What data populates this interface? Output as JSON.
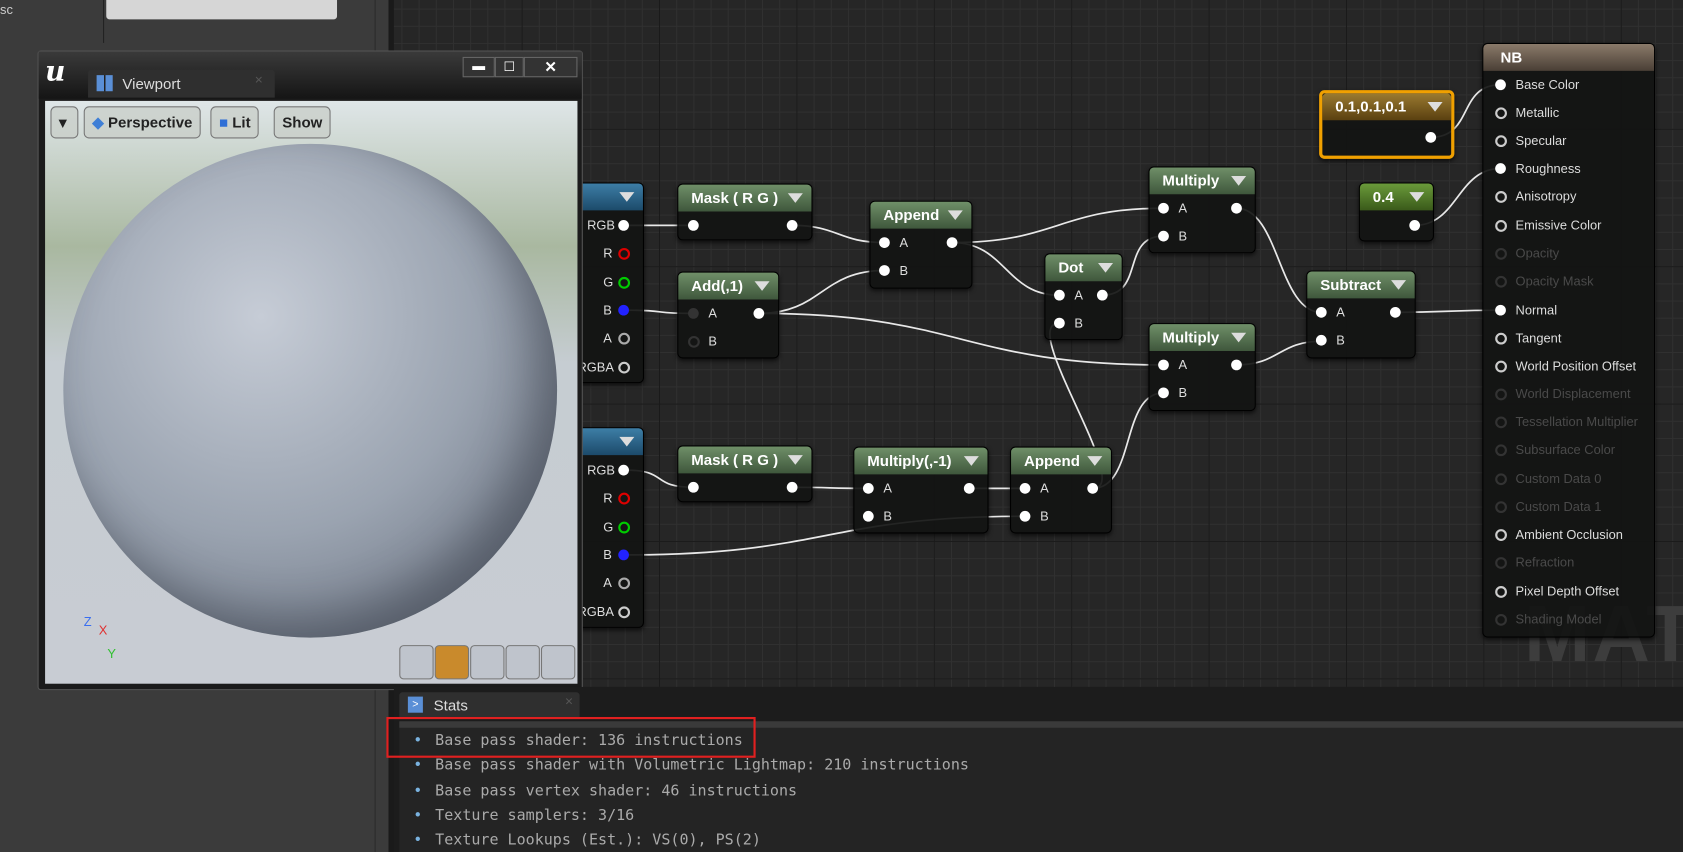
{
  "left_panel": {
    "label_fragment": "sc"
  },
  "viewport": {
    "tab_title": "Viewport",
    "view_mode": "Perspective",
    "lighting": "Lit",
    "show_label": "Show",
    "axes": {
      "x": "X",
      "y": "Y",
      "z": "Z"
    },
    "preview_shapes": [
      "cylinder-icon",
      "sphere-icon",
      "plane-icon",
      "cube-icon",
      "teapot-icon"
    ]
  },
  "nodes": {
    "texture_pins": [
      "RGB",
      "R",
      "G",
      "B",
      "A",
      "RGBA"
    ],
    "mask1": {
      "title": "Mask ( R G )"
    },
    "add": {
      "title": "Add(,1)",
      "pins": [
        "A",
        "B"
      ]
    },
    "append1": {
      "title": "Append",
      "pins": [
        "A",
        "B"
      ]
    },
    "dot": {
      "title": "Dot",
      "pins": [
        "A",
        "B"
      ]
    },
    "multiply1": {
      "title": "Multiply",
      "pins": [
        "A",
        "B"
      ]
    },
    "multiply2": {
      "title": "Multiply",
      "pins": [
        "A",
        "B"
      ]
    },
    "subtract": {
      "title": "Subtract",
      "pins": [
        "A",
        "B"
      ]
    },
    "const_04": {
      "title": "0.4"
    },
    "const_vec3": {
      "title": "0.1,0.1,0.1",
      "color": "#f0a000"
    },
    "mask2": {
      "title": "Mask ( R G )"
    },
    "multiply_neg": {
      "title": "Multiply(,-1)",
      "pins": [
        "A",
        "B"
      ]
    },
    "append2": {
      "title": "Append",
      "pins": [
        "A",
        "B"
      ]
    }
  },
  "material": {
    "title": "NB",
    "pins": [
      {
        "label": "Base Color",
        "state": "connected"
      },
      {
        "label": "Metallic",
        "state": "open"
      },
      {
        "label": "Specular",
        "state": "open"
      },
      {
        "label": "Roughness",
        "state": "connected"
      },
      {
        "label": "Anisotropy",
        "state": "open"
      },
      {
        "label": "Emissive Color",
        "state": "open"
      },
      {
        "label": "Opacity",
        "state": "disabled"
      },
      {
        "label": "Opacity Mask",
        "state": "disabled"
      },
      {
        "label": "Normal",
        "state": "connected"
      },
      {
        "label": "Tangent",
        "state": "open"
      },
      {
        "label": "World Position Offset",
        "state": "open"
      },
      {
        "label": "World Displacement",
        "state": "disabled"
      },
      {
        "label": "Tessellation Multiplier",
        "state": "disabled"
      },
      {
        "label": "Subsurface Color",
        "state": "disabled"
      },
      {
        "label": "Custom Data 0",
        "state": "disabled"
      },
      {
        "label": "Custom Data 1",
        "state": "disabled"
      },
      {
        "label": "Ambient Occlusion",
        "state": "open"
      },
      {
        "label": "Refraction",
        "state": "disabled"
      },
      {
        "label": "Pixel Depth Offset",
        "state": "open"
      },
      {
        "label": "Shading Model",
        "state": "disabled"
      }
    ],
    "watermark": "MATERIAL"
  },
  "stats": {
    "tab_title": "Stats",
    "lines": [
      "Base pass shader: 136 instructions",
      "Base pass shader with Volumetric Lightmap: 210 instructions",
      "Base pass vertex shader: 46 instructions",
      "Texture samplers: 3/16",
      "Texture Lookups (Est.): VS(0), PS(2)"
    ],
    "highlight_color": "#e02020"
  }
}
